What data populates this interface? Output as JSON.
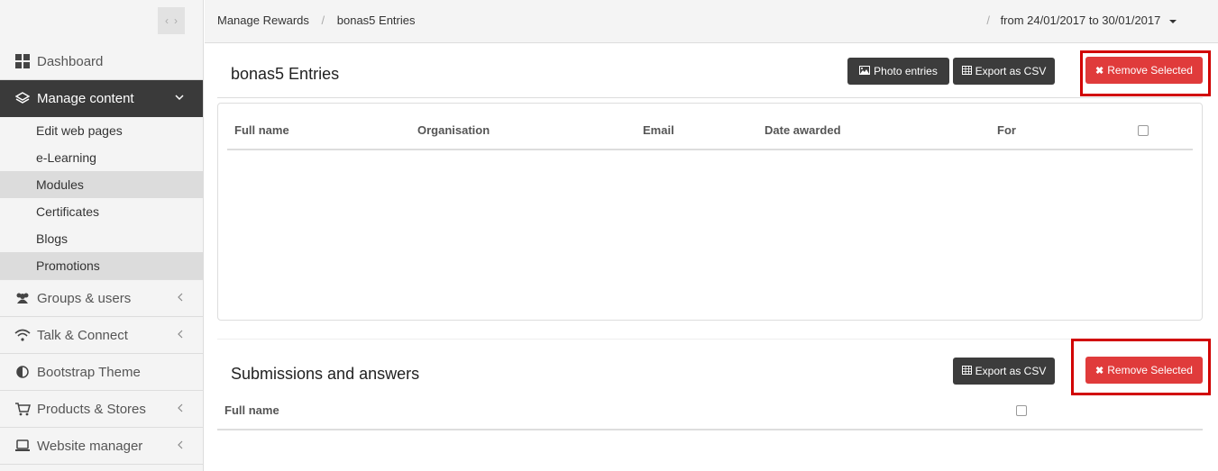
{
  "sidebar": {
    "items": [
      {
        "label": "Dashboard"
      },
      {
        "label": "Manage content"
      },
      {
        "label": "Groups & users"
      },
      {
        "label": "Talk & Connect"
      },
      {
        "label": "Bootstrap Theme"
      },
      {
        "label": "Products & Stores"
      },
      {
        "label": "Website manager"
      }
    ],
    "sub_items": [
      {
        "label": "Edit web pages"
      },
      {
        "label": "e-Learning"
      },
      {
        "label": "Modules"
      },
      {
        "label": "Certificates"
      },
      {
        "label": "Blogs"
      },
      {
        "label": "Promotions"
      }
    ]
  },
  "breadcrumb": {
    "parent": "Manage Rewards",
    "current": "bonas5 Entries",
    "separator": "/"
  },
  "date_range": {
    "label": "from 24/01/2017 to 30/01/2017"
  },
  "entries": {
    "title": "bonas5 Entries",
    "photo_button": "Photo entries",
    "export_button": "Export as CSV",
    "remove_button": "Remove Selected",
    "columns": [
      "Full name",
      "Organisation",
      "Email",
      "Date awarded",
      "For"
    ]
  },
  "submissions": {
    "title": "Submissions and answers",
    "export_button": "Export as CSV",
    "remove_button": "Remove Selected",
    "columns": [
      "Full name"
    ]
  },
  "colors": {
    "accent_red": "#e03b3b",
    "highlight": "#d10000",
    "dark_button": "#3c3c3c",
    "sidebar_active": "#3a3a3a"
  }
}
